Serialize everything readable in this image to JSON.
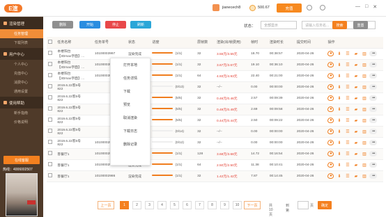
{
  "app": {
    "logo_text": "E渲",
    "username": "jianecech8",
    "balance": "500.67",
    "recharge_label": "充值"
  },
  "window_controls": [
    "—",
    "□",
    "✕"
  ],
  "sidebar": {
    "sections": [
      {
        "label": "渲染管理",
        "items": [
          "任务管理",
          "下载列表"
        ]
      },
      {
        "label": "用户中心",
        "items": [
          "个人中心",
          "充值中心",
          "消费中心",
          "通用设置"
        ]
      },
      {
        "label": "使用帮助",
        "items": [
          "新手指南",
          "价格说明"
        ]
      }
    ],
    "online_label": "在线客服",
    "hotline": "热线：4006002507"
  },
  "toolbar": {
    "delete_label": "删除",
    "start_label": "开始",
    "stop_label": "停止",
    "refresh_label": "刷新",
    "status_label": "状态：",
    "status_value": "全部显示",
    "search_placeholder": "请输入任务名...",
    "search_label": "搜索",
    "reset_label": "重置"
  },
  "table": {
    "headers": [
      "",
      "任务名称",
      "任务单号",
      "状态",
      "进度",
      "层帧数",
      "渲染(出/帧费用)",
      "帧时",
      "渲染时长",
      "提交时间",
      "操作"
    ],
    "rows": [
      {
        "name": "本楼阳台",
        "name2": "【3Dmax字面】…",
        "id": "10100003997",
        "status": "渲染完成",
        "pct": 100,
        "frames": "(1/1)",
        "layers": "32",
        "cost": "3.55元/3.55元",
        "fh": "18.70",
        "dur": "00:38:57",
        "date": "2020-04-26",
        "red": true
      },
      {
        "name": "本楼阳台",
        "name2": "【3Dmax字面】…",
        "id": "10100003997",
        "status": "渲染完成",
        "pct": 100,
        "frames": "(1/1)",
        "layers": "32",
        "cost": "3.67元/3.67元",
        "fh": "19.10",
        "dur": "00:36:10",
        "date": "2020-04-26",
        "red": true
      },
      {
        "name": "本楼阳台",
        "name2": "【3Dmax字面】…",
        "id": "10100003984",
        "status": "",
        "pct": 100,
        "frames": "(1/1)",
        "layers": "64",
        "cost": "4.93元/4.93元",
        "fh": "22.40",
        "dur": "00:21:00",
        "date": "2020-04-26",
        "red": true
      },
      {
        "name": "2019.6.22客5号",
        "name2": "822",
        "id": "",
        "status": "",
        "pct": 0,
        "frames": "(0/13)",
        "layers": "32",
        "cost": "--/--",
        "fh": "0.00",
        "dur": "00:00:00",
        "date": "2020-04-26",
        "red": false
      },
      {
        "name": "2019.6.22客5号",
        "name2": "822",
        "id": "",
        "status": "",
        "pct": 100,
        "frames": "(5/5)",
        "layers": "32",
        "cost": "0.46元/0.46元",
        "fh": "2.57",
        "dur": "00:09:39",
        "date": "2020-04-26",
        "red": true
      },
      {
        "name": "2019.6.22客5号",
        "name2": "822",
        "id": "",
        "status": "",
        "pct": 100,
        "frames": "(5/5)",
        "layers": "32",
        "cost": "0.49元/0.49元",
        "fh": "2.69",
        "dur": "00:09:58",
        "date": "2020-04-26",
        "red": true
      },
      {
        "name": "2019.6.22客5号",
        "name2": "822",
        "id": "",
        "status": "",
        "pct": 100,
        "frames": "(5/5)",
        "layers": "32",
        "cost": "0.44元/0.44元",
        "fh": "2.50",
        "dur": "00:09:22",
        "date": "2020-04-26",
        "red": true
      },
      {
        "name": "2019.6.22客5号",
        "name2": "822",
        "id": "",
        "status": "",
        "pct": 0,
        "frames": "(0/14)",
        "layers": "32",
        "cost": "--/--",
        "fh": "0.00",
        "dur": "00:00:00",
        "date": "2020-04-26",
        "red": false
      },
      {
        "name": "2019.6.22客5号",
        "name2": "822",
        "id": "10100002989",
        "status": "渲染取消",
        "pct": 0,
        "frames": "(0/12)",
        "layers": "32",
        "cost": "--/--",
        "fh": "0.00",
        "dur": "00:00:00",
        "date": "2020-04-26",
        "red": false
      },
      {
        "name": "客餐厅1",
        "name2": "",
        "id": "10100002988",
        "status": "渲染完成",
        "pct": 100,
        "frames": "(1/1)",
        "layers": "128",
        "cost": "3.68元/3.68元",
        "fh": "14.72",
        "dur": "00:16:54",
        "date": "2020-04-26",
        "red": true
      },
      {
        "name": "客餐厅1",
        "name2": "",
        "id": "10100002987",
        "status": "渲染完成",
        "pct": 100,
        "frames": "(1/1)",
        "layers": "64",
        "cost": "2.50元/2.50元",
        "fh": "11.38",
        "dur": "00:10:41",
        "date": "2020-04-26",
        "red": true
      },
      {
        "name": "客餐厅1",
        "name2": "",
        "id": "10100002986",
        "status": "渲染完成",
        "pct": 100,
        "frames": "(1/1)",
        "layers": "32",
        "cost": "1.42元/1.42元",
        "fh": "7.87",
        "dur": "00:14:45",
        "date": "2020-04-26",
        "red": true
      }
    ]
  },
  "context_menu": [
    "打开本地",
    "任务详情",
    "下载",
    "预览",
    "取消渲染",
    "下载日志",
    "删除记录"
  ],
  "pagination": {
    "prev": "上一页",
    "next": "下一页",
    "pages": [
      "1",
      "2",
      "3",
      "4",
      "5",
      "6",
      "7",
      "8",
      "9",
      "10"
    ],
    "current": "1",
    "total_label": "共10页",
    "jump_label": "到第",
    "page_unit": "页",
    "confirm": "确定"
  }
}
